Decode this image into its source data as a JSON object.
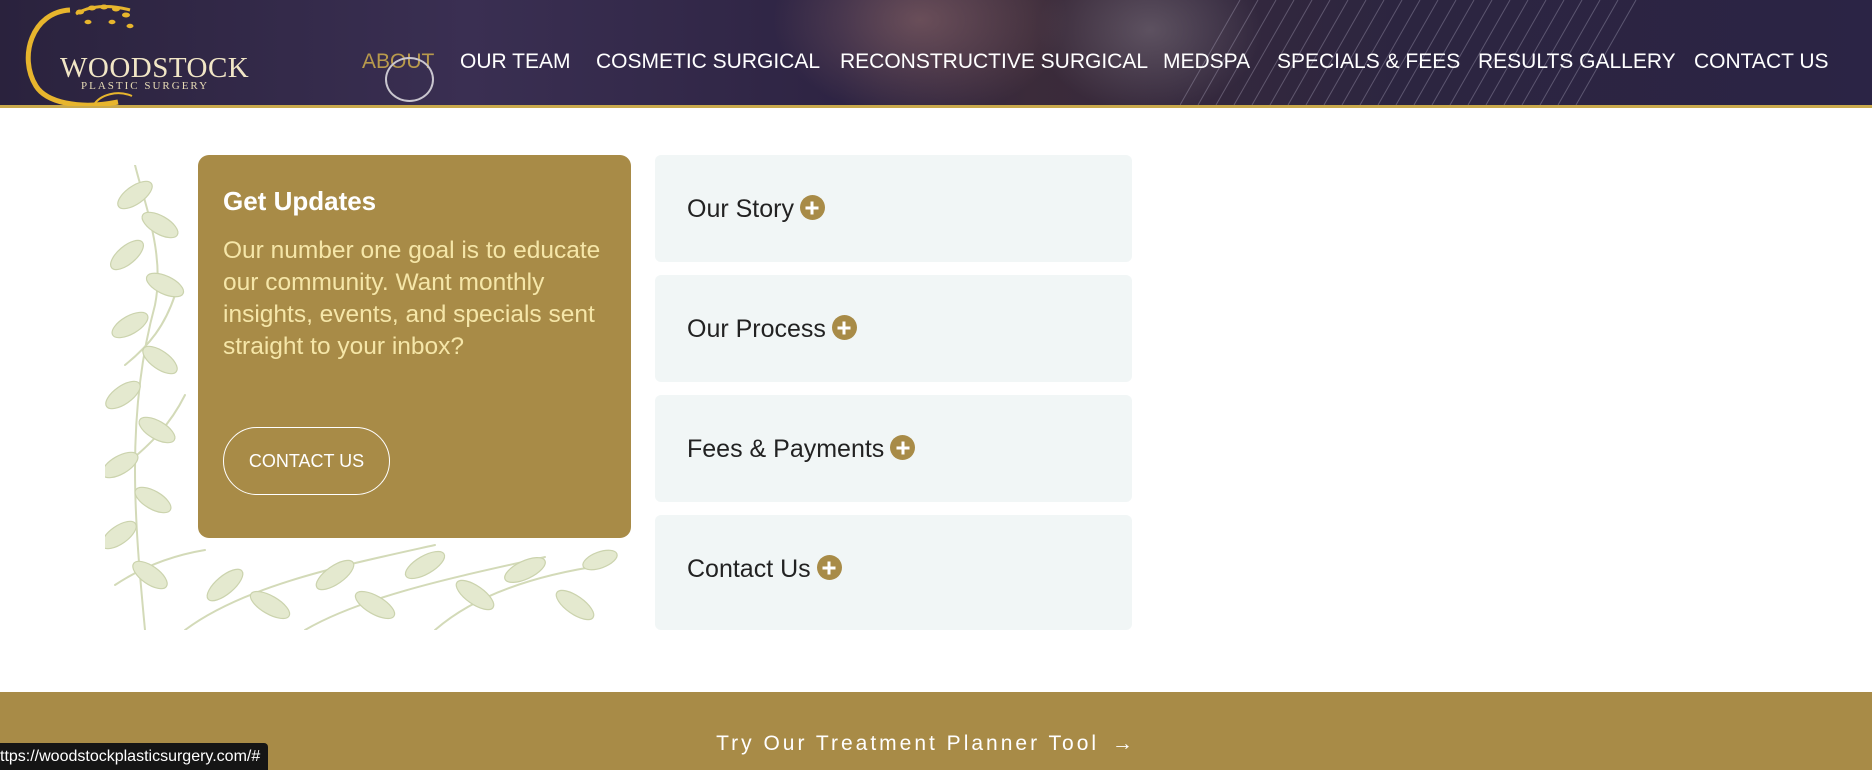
{
  "brand": {
    "name": "WOODSTOCK",
    "subtitle": "PLASTIC SURGERY"
  },
  "nav": {
    "items": [
      {
        "label": "ABOUT",
        "active": true
      },
      {
        "label": "OUR TEAM"
      },
      {
        "label": "COSMETIC SURGICAL"
      },
      {
        "label": "RECONSTRUCTIVE SURGICAL"
      },
      {
        "label": "MEDSPA"
      },
      {
        "label": "SPECIALS & FEES"
      },
      {
        "label": "RESULTS GALLERY"
      },
      {
        "label": "CONTACT US"
      }
    ]
  },
  "updates": {
    "title": "Get Updates",
    "text": "Our number one goal is to educate our community. Want monthly insights, events, and specials sent straight to your inbox?",
    "button_label": "CONTACT US"
  },
  "accordion": {
    "items": [
      {
        "label": "Our Story"
      },
      {
        "label": "Our Process"
      },
      {
        "label": "Fees & Payments"
      },
      {
        "label": "Contact Us"
      }
    ]
  },
  "cta": {
    "label": "Try Our Treatment Planner Tool",
    "arrow": "→"
  },
  "status_bar": {
    "url": "ttps://woodstockplasticsurgery.com/#"
  },
  "colors": {
    "gold": "#a88b47",
    "header_bg": "#2e2545",
    "accordion_bg": "#f1f6f6",
    "active_nav": "#b89a4c"
  },
  "icons": [
    "logo-tree-icon",
    "plus-circle-icon",
    "arrow-right-icon",
    "leaf-decoration"
  ]
}
